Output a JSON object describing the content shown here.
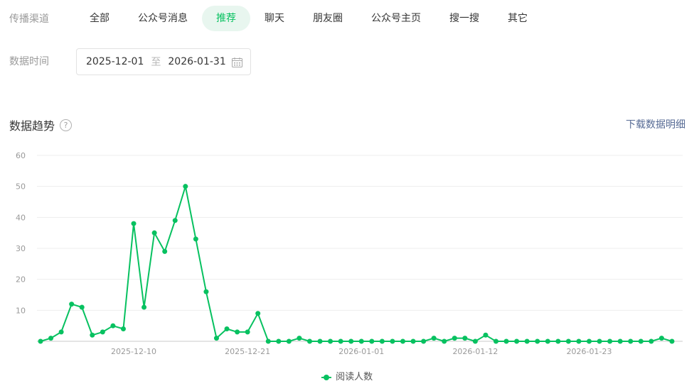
{
  "filters": {
    "channel_label": "传播渠道",
    "channels": [
      "全部",
      "公众号消息",
      "推荐",
      "聊天",
      "朋友圈",
      "公众号主页",
      "搜一搜",
      "其它"
    ],
    "active_channel": "推荐",
    "time_label": "数据时间",
    "date_start": "2025-12-01",
    "date_sep": "至",
    "date_end": "2026-01-31"
  },
  "trend": {
    "title": "数据趋势",
    "help": "?",
    "download": "下载数据明细"
  },
  "chart_data": {
    "type": "line",
    "x_start": "2025-12-01",
    "x_end": "2026-01-31",
    "x_ticks": [
      "2025-12-10",
      "2025-12-21",
      "2026-01-01",
      "2026-01-12",
      "2026-01-23"
    ],
    "ylim": [
      0,
      60
    ],
    "y_ticks": [
      10,
      20,
      30,
      40,
      50,
      60
    ],
    "grid": true,
    "legend_position": "bottom-center",
    "color": "#07c160",
    "series": [
      {
        "name": "阅读人数",
        "values": [
          0,
          1,
          3,
          12,
          11,
          2,
          3,
          5,
          4,
          38,
          11,
          35,
          29,
          39,
          50,
          33,
          16,
          1,
          4,
          3,
          3,
          9,
          0,
          0,
          0,
          1,
          0,
          0,
          0,
          0,
          0,
          0,
          0,
          0,
          0,
          0,
          0,
          0,
          1,
          0,
          1,
          1,
          0,
          2,
          0,
          0,
          0,
          0,
          0,
          0,
          0,
          0,
          0,
          0,
          0,
          0,
          0,
          0,
          0,
          0,
          1,
          0
        ]
      }
    ]
  }
}
